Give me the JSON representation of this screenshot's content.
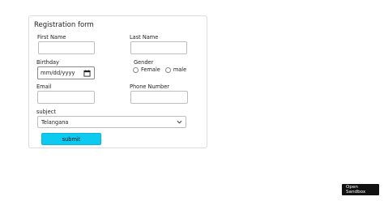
{
  "form": {
    "title": "Registration form",
    "first_name_label": "First Name",
    "last_name_label": "Last Name",
    "birthday_label": "Birthday",
    "birthday_placeholder": "mm/dd/yyyy",
    "gender_label": "Gender",
    "gender_options": [
      "Female",
      "male"
    ],
    "email_label": "Email",
    "phone_label": "Phone Number",
    "subject_label": "subject",
    "subject_selected": "Telangana",
    "submit_label": "submit"
  },
  "sandbox": {
    "line1": "Open",
    "line2": "Sandbox"
  },
  "colors": {
    "submit_bg": "#0dcaf0",
    "sandbox_bg": "#111111"
  }
}
